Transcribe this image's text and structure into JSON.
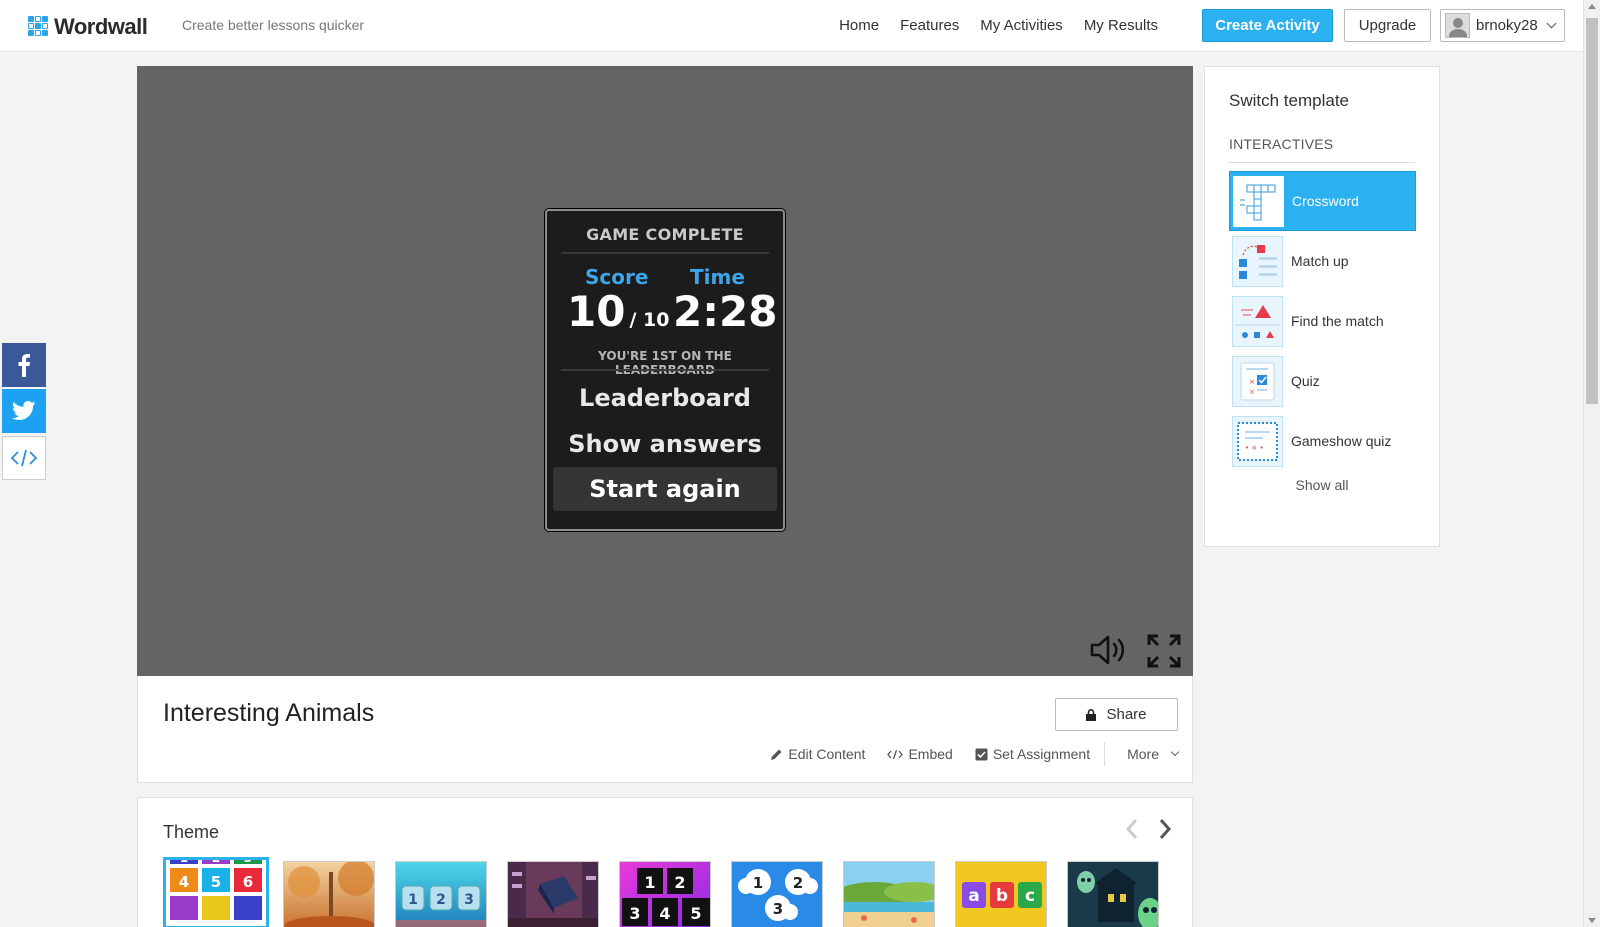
{
  "header": {
    "logo_text": "Wordwall",
    "tagline": "Create better lessons quicker",
    "nav": [
      "Home",
      "Features",
      "My Activities",
      "My Results"
    ],
    "create_label": "Create Activity",
    "upgrade_label": "Upgrade",
    "username": "brnoky28"
  },
  "game": {
    "title": "GAME COMPLETE",
    "score_label": "Score",
    "score_value": "10",
    "score_total": "/ 10",
    "time_label": "Time",
    "time_value": "2:28",
    "leaderboard_text": "YOU'RE 1ST ON THE LEADERBOARD",
    "buttons": [
      "Leaderboard",
      "Show answers",
      "Start again"
    ]
  },
  "activity": {
    "title": "Interesting Animals",
    "share_label": "Share",
    "actions": [
      "Edit Content",
      "Embed",
      "Set Assignment",
      "More"
    ]
  },
  "theme": {
    "title": "Theme"
  },
  "sidebar": {
    "title": "Switch template",
    "section": "INTERACTIVES",
    "templates": [
      "Crossword",
      "Match up",
      "Find the match",
      "Quiz",
      "Gameshow quiz"
    ],
    "show_all": "Show all"
  },
  "colors": {
    "accent": "#2bb0f0",
    "score_blue": "#3ea6e8",
    "game_bg": "#646464",
    "facebook": "#3b5998",
    "twitter": "#1da1f2"
  }
}
